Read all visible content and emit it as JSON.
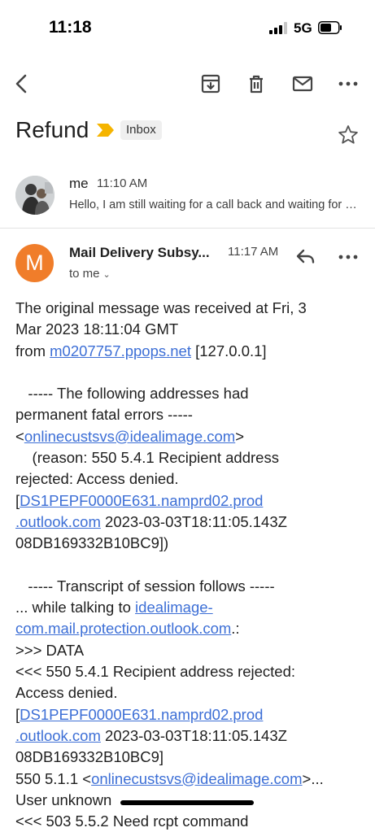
{
  "status": {
    "time": "11:18",
    "network": "5G"
  },
  "email": {
    "subject": "Refund",
    "label": "Inbox",
    "messages": [
      {
        "sender": "me",
        "time": "11:10 AM",
        "snippet": "Hello, I am still waiting for a call back and waiting for my refund"
      },
      {
        "avatar_letter": "M",
        "sender": "Mail Delivery Subsy...",
        "time": "11:17 AM",
        "to": "to me"
      }
    ]
  },
  "body": {
    "l1": "The original message was received at Fri, 3",
    "l2": "Mar 2023 18:11:04 GMT",
    "l3_a": "from ",
    "l3_link": "m0207757.ppops.net",
    "l3_b": " [127.0.0.1]",
    "l5": "   ----- The following addresses had",
    "l6": "permanent fatal errors -----",
    "l7_a": "<",
    "l7_link": "onlinecustsvs@idealimage.com",
    "l7_b": ">",
    "l8": "    (reason: 550 5.4.1 Recipient address",
    "l9": "rejected: Access denied.",
    "l10_a": "[",
    "l10_link": "DS1PEPF0000E631.namprd02.prod",
    "l11_link": ".outlook.com",
    "l11_b": " 2023-03-03T18:11:05.143Z",
    "l12": "08DB169332B10BC9])",
    "l14": "   ----- Transcript of session follows -----",
    "l15_a": "... while talking to ",
    "l15_link": "idealimage-",
    "l16_link": "com.mail.protection.outlook.com",
    "l16_b": ".:",
    "l17": ">>> DATA",
    "l18": "<<< 550 5.4.1 Recipient address rejected:",
    "l19": "Access denied.",
    "l20_a": "[",
    "l20_link": "DS1PEPF0000E631.namprd02.prod",
    "l21_link": ".outlook.com",
    "l21_b": " 2023-03-03T18:11:05.143Z",
    "l22": "08DB169332B10BC9]",
    "l23_a": "550 5.1.1 <",
    "l23_link": "onlinecustsvs@idealimage.com",
    "l23_b": ">...",
    "l24": "User unknown",
    "l25": "<<< 503 5.5.2 Need rcpt command"
  },
  "colors": {
    "accent_link": "#3d6fd6",
    "avatar_m": "#f07d2a",
    "important": "#f5b400"
  },
  "icons": [
    "back-icon",
    "archive-icon",
    "trash-icon",
    "mail-icon",
    "more-icon",
    "importance-icon",
    "star-icon",
    "reply-icon"
  ]
}
